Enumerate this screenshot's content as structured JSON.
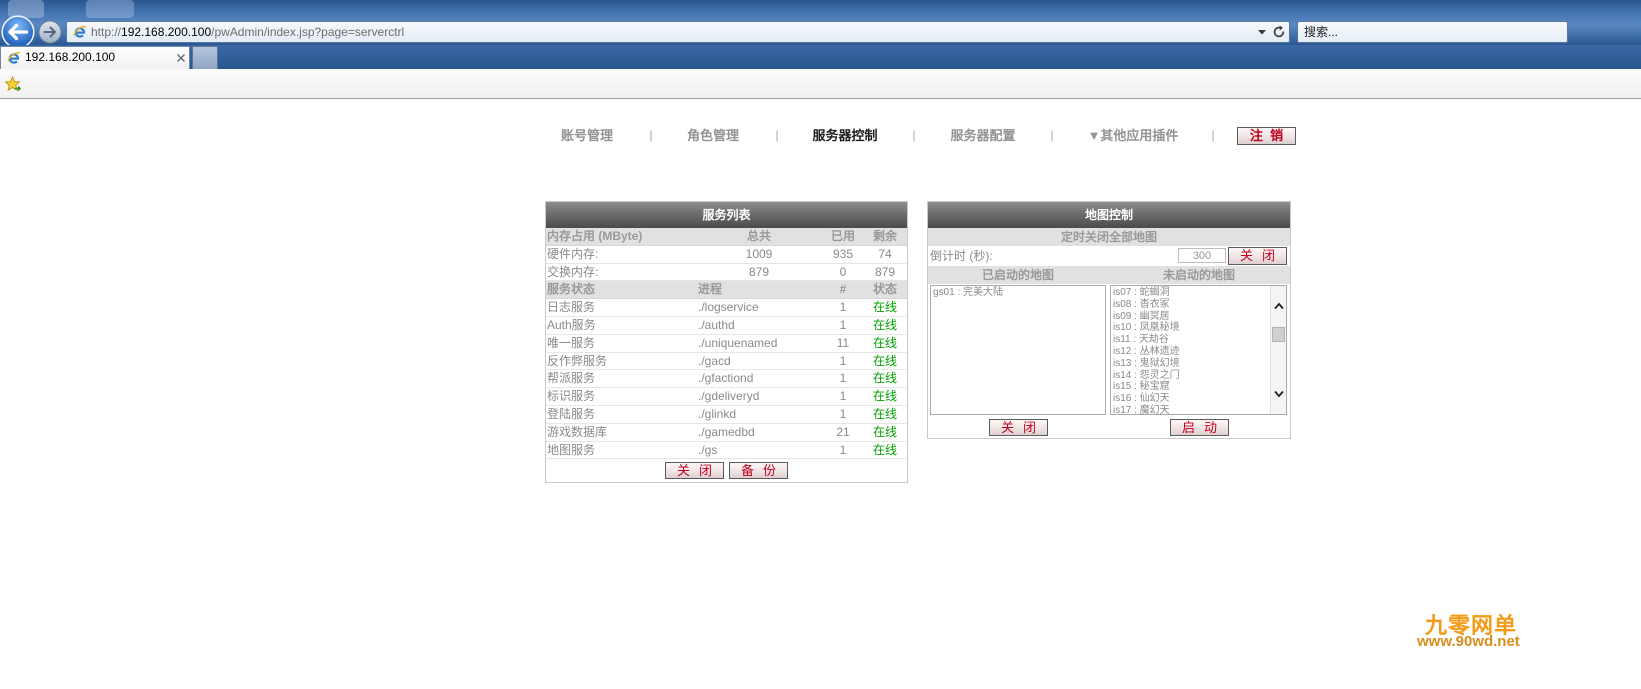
{
  "browser": {
    "url_scheme": "http://",
    "url_host": "192.168.200.100",
    "url_path": "/pwAdmin/index.jsp?page=serverctrl",
    "search_placeholder": "搜索...",
    "tab_title": "192.168.200.100"
  },
  "nav": {
    "items": [
      {
        "label": "账号管理",
        "active": false
      },
      {
        "label": "角色管理",
        "active": false
      },
      {
        "label": "服务器控制",
        "active": true
      },
      {
        "label": "服务器配置",
        "active": false
      },
      {
        "label": "▼其他应用插件",
        "active": false
      }
    ],
    "separator": "|",
    "logout_label": "注 销"
  },
  "service_list": {
    "title": "服务列表",
    "memory_columns": [
      "内存占用 (MByte)",
      "总共",
      "已用",
      "剩余"
    ],
    "memory_rows": [
      {
        "name": "硬件内存:",
        "total": "1009",
        "used": "935",
        "free": "74"
      },
      {
        "name": "交换内存:",
        "total": "879",
        "used": "0",
        "free": "879"
      }
    ],
    "service_columns": [
      "服务状态",
      "进程",
      "#",
      "状态"
    ],
    "services": [
      {
        "name": "日志服务",
        "process": "./logservice",
        "count": "1",
        "status": "在线"
      },
      {
        "name": "Auth服务",
        "process": "./authd",
        "count": "1",
        "status": "在线"
      },
      {
        "name": "唯一服务",
        "process": "./uniquenamed",
        "count": "11",
        "status": "在线"
      },
      {
        "name": "反作弊服务",
        "process": "./gacd",
        "count": "1",
        "status": "在线"
      },
      {
        "name": "帮派服务",
        "process": "./gfactiond",
        "count": "1",
        "status": "在线"
      },
      {
        "name": "标识服务",
        "process": "./gdeliveryd",
        "count": "1",
        "status": "在线"
      },
      {
        "name": "登陆服务",
        "process": "./glinkd",
        "count": "1",
        "status": "在线"
      },
      {
        "name": "游戏数据库",
        "process": "./gamedbd",
        "count": "21",
        "status": "在线"
      },
      {
        "name": "地图服务",
        "process": "./gs",
        "count": "1",
        "status": "在线"
      }
    ],
    "close_label": "关闭",
    "backup_label": "备份"
  },
  "map_control": {
    "title": "地图控制",
    "timed_close_title": "定时关闭全部地图",
    "countdown_label": "倒计时 (秒):",
    "countdown_value": "300",
    "countdown_close_label": "关闭",
    "started_maps_title": "已启动的地图",
    "stopped_maps_title": "未启动的地图",
    "started_maps": [
      "gs01 : 完美大陆"
    ],
    "stopped_maps": [
      "is07 : 蛇蝎洞",
      "is08 : 杳衣冢",
      "is09 : 幽冥居",
      "is10 : 凤凰秘境",
      "is11 : 天劫谷",
      "is12 : 丛林遗迹",
      "is13 : 鬼狱幻境",
      "is14 : 怨灵之门",
      "is15 : 秘宝窟",
      "is16 : 仙幻天",
      "is17 : 魔幻天"
    ],
    "close_label": "关闭",
    "start_label": "启动"
  },
  "watermark": {
    "name": "九零网单",
    "url": "www.90wd.net"
  },
  "colors": {
    "online_status": "#00a000",
    "button_text": "#c00020",
    "panel_header": "#5a5a5a",
    "watermark": "#f29b16"
  },
  "icons": {
    "back": "back-arrow-icon",
    "forward": "forward-arrow-icon",
    "site": "ie-favicon-icon",
    "dropdown": "dropdown-arrow-icon",
    "refresh": "refresh-icon",
    "tab_close": "close-icon",
    "favorites": "favorites-star-icon",
    "scroll_up": "scroll-up-icon",
    "scroll_down": "scroll-down-icon"
  }
}
